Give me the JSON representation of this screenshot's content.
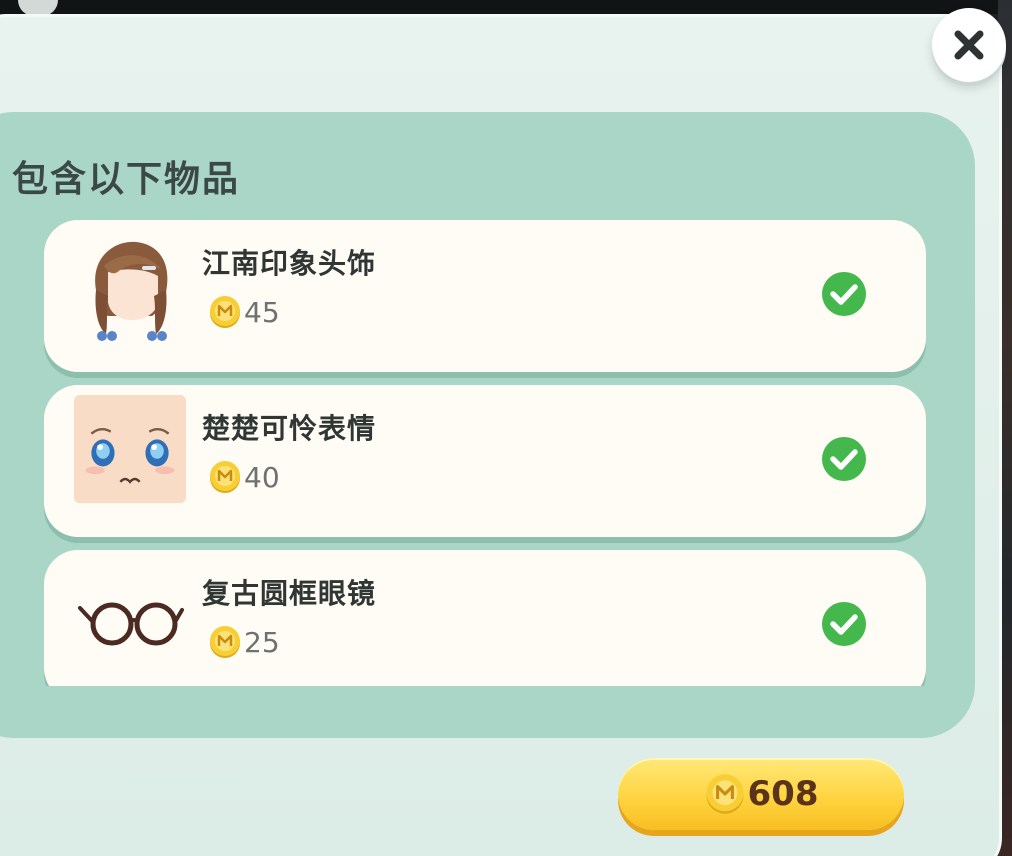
{
  "dialog": {
    "title": "包含以下物品",
    "items": [
      {
        "name": "江南印象头饰",
        "price": "45",
        "icon": "hair-accessory-icon",
        "owned": true
      },
      {
        "name": "楚楚可怜表情",
        "price": "40",
        "icon": "face-expression-icon",
        "owned": true
      },
      {
        "name": "复古圆框眼镜",
        "price": "25",
        "icon": "round-glasses-icon",
        "owned": true
      }
    ],
    "total_price": "608"
  },
  "colors": {
    "panel": "#e2f0eb",
    "inner": "#a9d6c6",
    "card": "#fffcf5",
    "check": "#44b84c",
    "coin": "#f2c12b",
    "button": "#ffd23c"
  }
}
